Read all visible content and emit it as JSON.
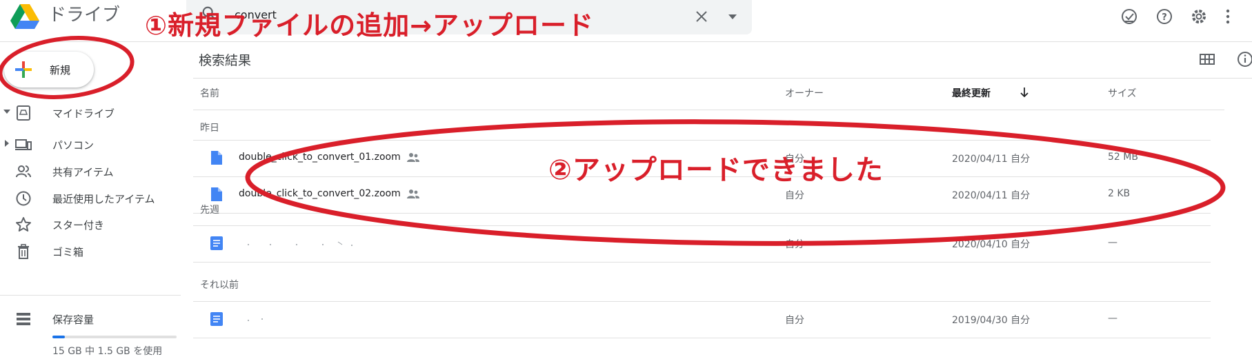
{
  "header": {
    "app_title": "ドライブ",
    "search_query": "convert",
    "icons": [
      "logo-icon",
      "search-icon",
      "clear-icon",
      "chevron-down-icon",
      "offline-check-icon",
      "help-icon",
      "gear-icon",
      "more-vert-icon"
    ]
  },
  "sidebar": {
    "new_label": "新規",
    "items": [
      {
        "label": "マイドライブ",
        "icon": "my-drive-icon",
        "expandable": true
      },
      {
        "label": "パソコン",
        "icon": "computer-icon",
        "expandable": true
      },
      {
        "label": "共有アイテム",
        "icon": "shared-people-icon",
        "expandable": false
      },
      {
        "label": "最近使用したアイテム",
        "icon": "clock-icon",
        "expandable": false
      },
      {
        "label": "スター付き",
        "icon": "star-icon",
        "expandable": false
      },
      {
        "label": "ゴミ箱",
        "icon": "trash-icon",
        "expandable": false
      }
    ],
    "storage": {
      "label": "保存容量",
      "usage_text": "15 GB 中 1.5 GB を使用",
      "used_fraction": 0.1
    }
  },
  "main": {
    "title": "検索結果",
    "columns": {
      "name": "名前",
      "owner": "オーナー",
      "modified": "最終更新",
      "size": "サイズ"
    },
    "sections": [
      {
        "label": "昨日",
        "rows": [
          {
            "name": "double_click_to_convert_01.zoom",
            "shared": true,
            "owner": "自分",
            "modified": "2020/04/11 自分",
            "size": "52 MB",
            "file_type": "file-icon"
          },
          {
            "name": "double_click_to_convert_02.zoom",
            "shared": true,
            "owner": "自分",
            "modified": "2020/04/11 自分",
            "size": "2 KB",
            "file_type": "file-icon"
          }
        ]
      },
      {
        "label": "先週",
        "rows": [
          {
            "name": "",
            "shared": false,
            "owner": "自分",
            "modified": "2020/04/10 自分",
            "size": "—",
            "file_type": "doc-icon"
          }
        ]
      },
      {
        "label": "それ以前",
        "rows": [
          {
            "name": "",
            "shared": false,
            "owner": "自分",
            "modified": "2019/04/30 自分",
            "size": "—",
            "file_type": "doc-icon"
          }
        ]
      }
    ]
  },
  "annotations": {
    "step1": "①新規ファイルの追加→アップロード",
    "step2": "②アップロードできました",
    "color": "#d91f2a"
  },
  "colors": {
    "accent": "#1a73e8",
    "annotation": "#d91f2a"
  }
}
